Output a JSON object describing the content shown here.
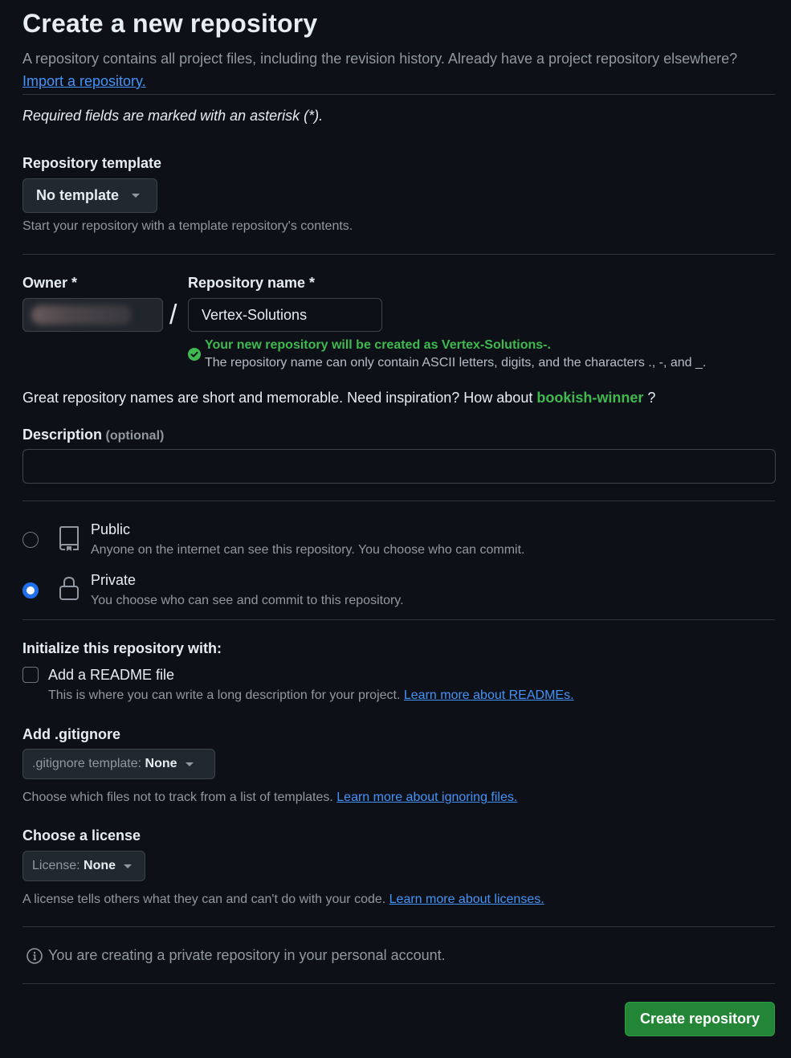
{
  "header": {
    "title": "Create a new repository",
    "intro_text": "A repository contains all project files, including the revision history. Already have a project repository elsewhere?",
    "import_link": "Import a repository."
  },
  "required_note": "Required fields are marked with an asterisk (*).",
  "template": {
    "label": "Repository template",
    "selected": "No template",
    "hint": "Start your repository with a template repository's contents."
  },
  "owner": {
    "label": "Owner *",
    "value": ""
  },
  "separator": "/",
  "repo_name": {
    "label": "Repository name *",
    "value": "Vertex-Solutions",
    "success_message": "Your new repository will be created as Vertex-Solutions-.",
    "rule_text": "The repository name can only contain ASCII letters, digits, and the characters ., -, and _."
  },
  "inspiration": {
    "text": "Great repository names are short and memorable. Need inspiration? How about",
    "suggestion": "bookish-winner",
    "suffix": "?"
  },
  "description": {
    "label": "Description",
    "optional": "(optional)",
    "value": ""
  },
  "visibility": {
    "selected": "private",
    "options": [
      {
        "id": "public",
        "label": "Public",
        "description": "Anyone on the internet can see this repository. You choose who can commit.",
        "icon": "repo-icon"
      },
      {
        "id": "private",
        "label": "Private",
        "description": "You choose who can see and commit to this repository.",
        "icon": "lock-icon"
      }
    ]
  },
  "initialize": {
    "label": "Initialize this repository with:",
    "readme_label": "Add a README file",
    "readme_checked": false,
    "readme_hint": "This is where you can write a long description for your project.",
    "readme_link": "Learn more about READMEs."
  },
  "gitignore": {
    "label": "Add .gitignore",
    "select_prefix": ".gitignore template:",
    "select_value": "None",
    "hint": "Choose which files not to track from a list of templates.",
    "link": "Learn more about ignoring files."
  },
  "license": {
    "label": "Choose a license",
    "select_prefix": "License:",
    "select_value": "None",
    "hint": "A license tells others what they can and can't do with your code.",
    "link": "Learn more about licenses."
  },
  "info_note": "You are creating a private repository in your personal account.",
  "submit_label": "Create repository",
  "colors": {
    "background": "#0d1117",
    "accent_green": "#3fb950",
    "button_green": "#238636",
    "link_blue": "#4493f8",
    "radio_blue": "#1f6feb"
  }
}
